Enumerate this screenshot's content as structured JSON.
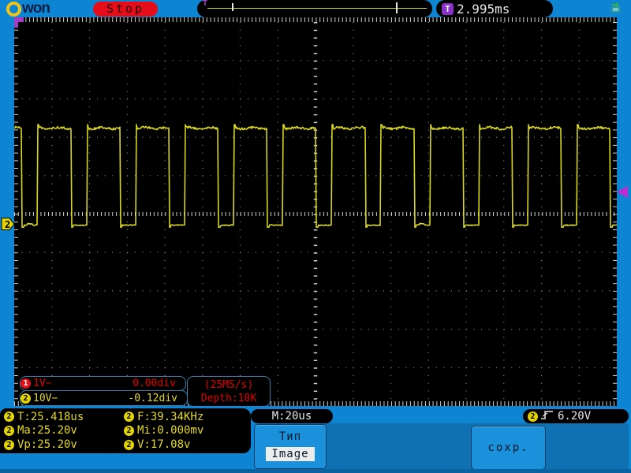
{
  "header": {
    "logo_text": "won",
    "run_state": "Stop",
    "memory_marker": "T",
    "trigger_icon": "T",
    "trigger_time": "2.995ms"
  },
  "scope": {
    "grid": {
      "h_divs": 16,
      "v_divs": 10
    },
    "ch2_marker": "2",
    "ch1": {
      "badge": "1",
      "scale": "1V−",
      "position": "0.00div"
    },
    "ch2": {
      "badge": "2",
      "scale": "10V−",
      "position": "-0.12div"
    },
    "sample_rate": "(25MS/s)",
    "depth": "Depth:10K"
  },
  "chart_data": {
    "type": "line",
    "signal": "square",
    "channel": "CH2",
    "volts_per_div": 10,
    "time_per_div_us": 20,
    "v_high": 25.2,
    "v_low": 0.0,
    "v_mean": 17.08,
    "period_us": 25.418,
    "frequency_khz": 39.34,
    "duty_high": 0.68,
    "ch2_offset_div": -0.12,
    "trigger_level_v": 6.2
  },
  "bottom": {
    "timebase": "M:20us",
    "trigger": {
      "badge": "2",
      "level": "6.20V"
    },
    "measurements": [
      {
        "badge": "2",
        "text": "T:25.418us"
      },
      {
        "badge": "2",
        "text": "F:39.34KHz"
      },
      {
        "badge": "2",
        "text": "Ma:25.20v"
      },
      {
        "badge": "2",
        "text": "Mi:0.000mv"
      },
      {
        "badge": "2",
        "text": "Vp:25.20v"
      },
      {
        "badge": "2",
        "text": "V:17.08v"
      }
    ],
    "menu": {
      "type_label": "Тип",
      "type_value": "Image",
      "save_label": "сохр."
    }
  },
  "colors": {
    "trace_yellow": "#d8d61e",
    "ch1_red": "#e60d1a",
    "ch2_yellow": "#e3d400",
    "trigger_purple": "#a43cc8",
    "trigger_arrow_magenta": "#bb2fd0",
    "grid_dot": "#8f8f8f",
    "tick_white": "#cfcfcf",
    "screen_black": "#000000",
    "frame_blue": "#0e85d3"
  }
}
